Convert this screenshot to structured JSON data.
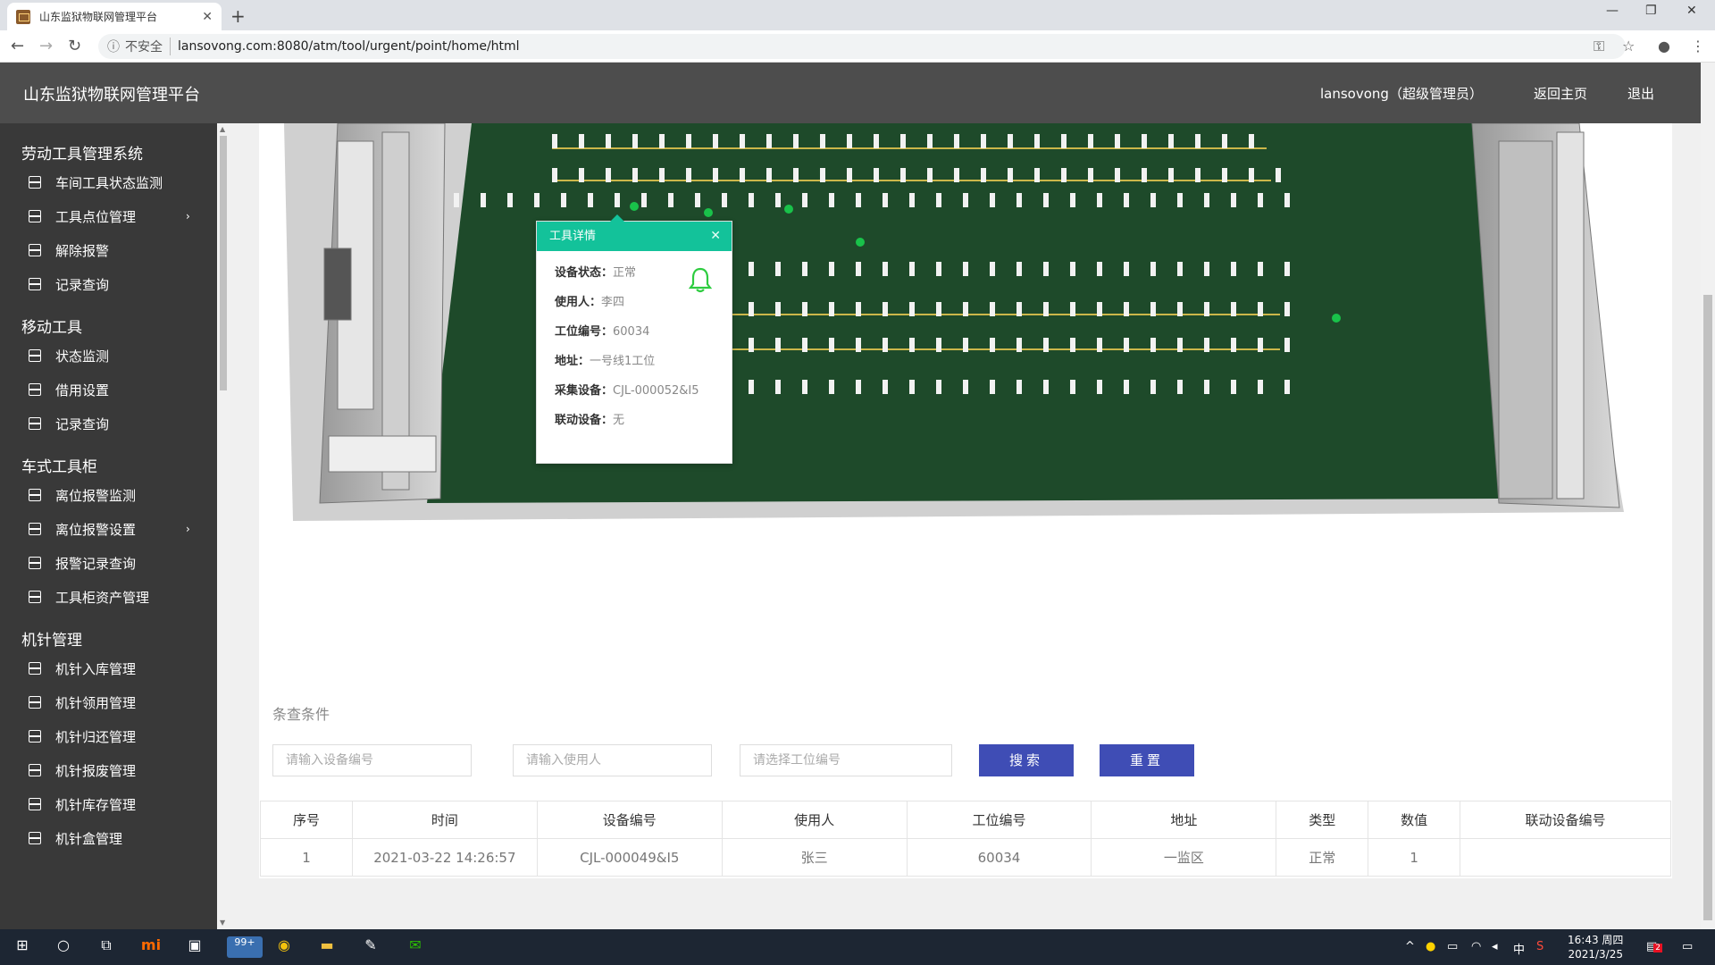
{
  "browser": {
    "tab_title": "山东监狱物联网管理平台",
    "insecure_label": "不安全",
    "url": "lansovong.com:8080/atm/tool/urgent/point/home/html"
  },
  "header": {
    "brand": "山东监狱物联网管理平台",
    "user": "lansovong（超级管理员）",
    "home": "返回主页",
    "logout": "退出"
  },
  "sidebar": {
    "groups": [
      {
        "title": "劳动工具管理系统",
        "items": [
          "车间工具状态监测",
          "工具点位管理",
          "解除报警",
          "记录查询"
        ]
      },
      {
        "title": "移动工具",
        "items": [
          "状态监测",
          "借用设置",
          "记录查询"
        ]
      },
      {
        "title": "车式工具柜",
        "items": [
          "离位报警监测",
          "离位报警设置",
          "报警记录查询",
          "工具柜资产管理"
        ]
      },
      {
        "title": "机针管理",
        "items": [
          "机针入库管理",
          "机针领用管理",
          "机针归还管理",
          "机针报废管理",
          "机针库存管理",
          "机针盒管理"
        ]
      }
    ]
  },
  "popup": {
    "title": "工具详情",
    "rows": [
      {
        "label": "设备状态：",
        "value": "正常"
      },
      {
        "label": "使用人：",
        "value": "李四"
      },
      {
        "label": "工位编号：",
        "value": "60034"
      },
      {
        "label": "地址：",
        "value": "一号线1工位"
      },
      {
        "label": "采集设备：",
        "value": "CJL-000052&I5"
      },
      {
        "label": "联动设备：",
        "value": "无"
      }
    ],
    "bell_color": "#2ecc40"
  },
  "query": {
    "title": "条查条件",
    "device_placeholder": "请输入设备编号",
    "user_placeholder": "请输入使用人",
    "station_placeholder": "请选择工位编号",
    "search_label": "搜索",
    "reset_label": "重置"
  },
  "table": {
    "headers": [
      "序号",
      "时间",
      "设备编号",
      "使用人",
      "工位编号",
      "地址",
      "类型",
      "数值",
      "联动设备编号"
    ],
    "rows": [
      [
        "1",
        "2021-03-22 14:26:57",
        "CJL-000049&I5",
        "张三",
        "60034",
        "一监区",
        "正常",
        "1",
        ""
      ]
    ]
  },
  "taskbar": {
    "badge": "99+",
    "time": "16:43 周四",
    "date": "2021/3/25",
    "ime": "中",
    "notify_count": "2"
  },
  "colors": {
    "header_bg": "#4d4d4d",
    "sidebar_bg": "#393939",
    "popup_accent": "#13c29a",
    "button_bg": "#3f4db5",
    "floor_green": "#1e4a2a"
  }
}
